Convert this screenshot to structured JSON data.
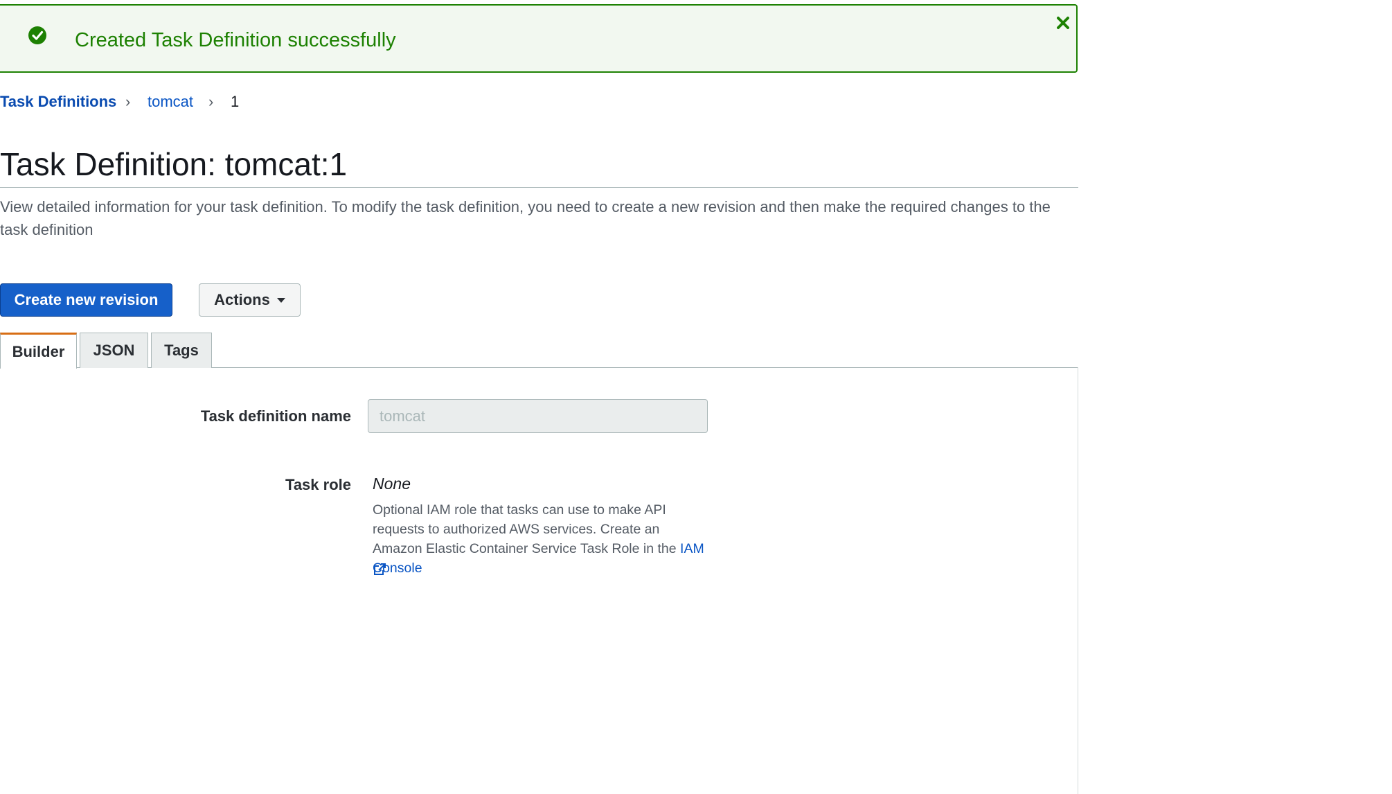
{
  "flash": {
    "message": "Created Task Definition successfully",
    "status": "success",
    "color": "#1d8102"
  },
  "breadcrumb": {
    "items": [
      "Task Definitions",
      "tomcat",
      "1"
    ],
    "separator": "›"
  },
  "page": {
    "title": "Task Definition: tomcat:1",
    "description": "View detailed information for your task definition. To modify the task definition, you need to create a new revision and then make the required changes to the task definition"
  },
  "toolbar": {
    "create_label": "Create new revision",
    "actions_label": "Actions"
  },
  "tabs": [
    {
      "label": "Builder",
      "active": true
    },
    {
      "label": "JSON",
      "active": false
    },
    {
      "label": "Tags",
      "active": false
    }
  ],
  "form": {
    "name_label": "Task definition name",
    "name_value": "tomcat",
    "role_label": "Task role",
    "role_value": "None",
    "role_help": "Optional IAM role that tasks can use to make API requests to authorized AWS services. Create an Amazon Elastic Container Service Task Role in the",
    "role_help_link": "IAM Console"
  },
  "colors": {
    "primary": "#1660c9",
    "link": "#0a55c4",
    "active_tab": "#d76e15"
  }
}
